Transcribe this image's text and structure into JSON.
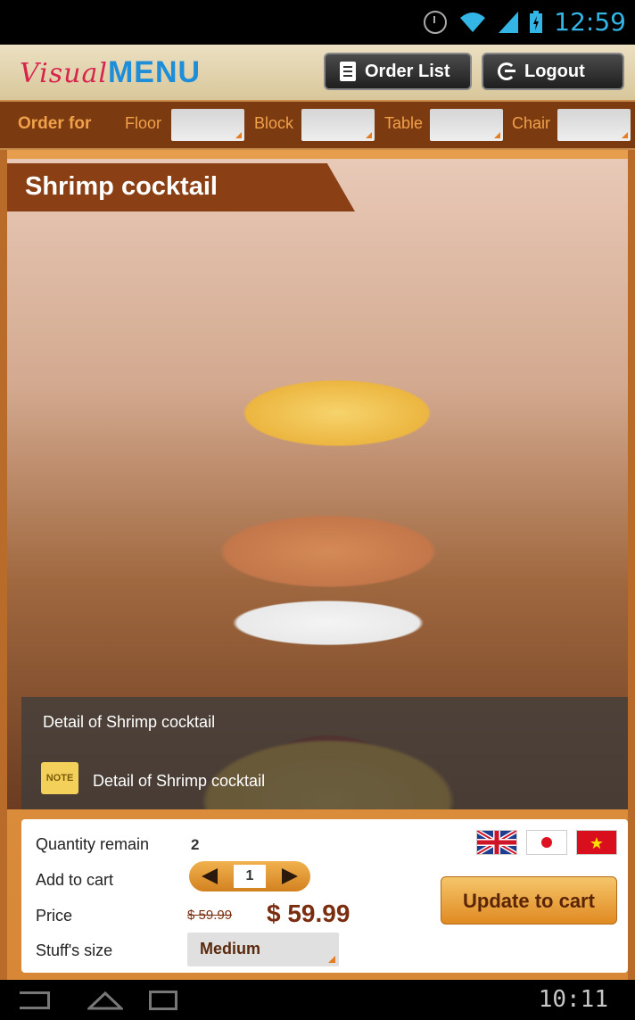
{
  "status_bar": {
    "time": "12:59"
  },
  "header": {
    "logo_visual": "Visual",
    "logo_menu": "MENU",
    "order_list_label": "Order List",
    "logout_label": "Logout"
  },
  "order_bar": {
    "order_for": "Order for",
    "floor": "Floor",
    "block": "Block",
    "table": "Table",
    "chair": "Chair"
  },
  "dish": {
    "title": "Shrimp cocktail",
    "detail": "Detail of Shrimp cocktail",
    "note_detail": "Detail of Shrimp cocktail",
    "note_label": "NOTE"
  },
  "panel": {
    "quantity_remain_label": "Quantity remain",
    "quantity_remain_value": "2",
    "add_to_cart_label": "Add to cart",
    "add_to_cart_value": "1",
    "price_label": "Price",
    "old_price": "$ 59.99",
    "new_price": "$ 59.99",
    "size_label": "Stuff's size",
    "size_value": "Medium",
    "update_button": "Update to cart"
  },
  "navigation_bar": {
    "clock": "10:11"
  },
  "colors": {
    "brand_red": "#d6244d",
    "brand_blue": "#1f8ed8",
    "accent_orange": "#e08a22",
    "bar_brown": "#7c3a10"
  }
}
